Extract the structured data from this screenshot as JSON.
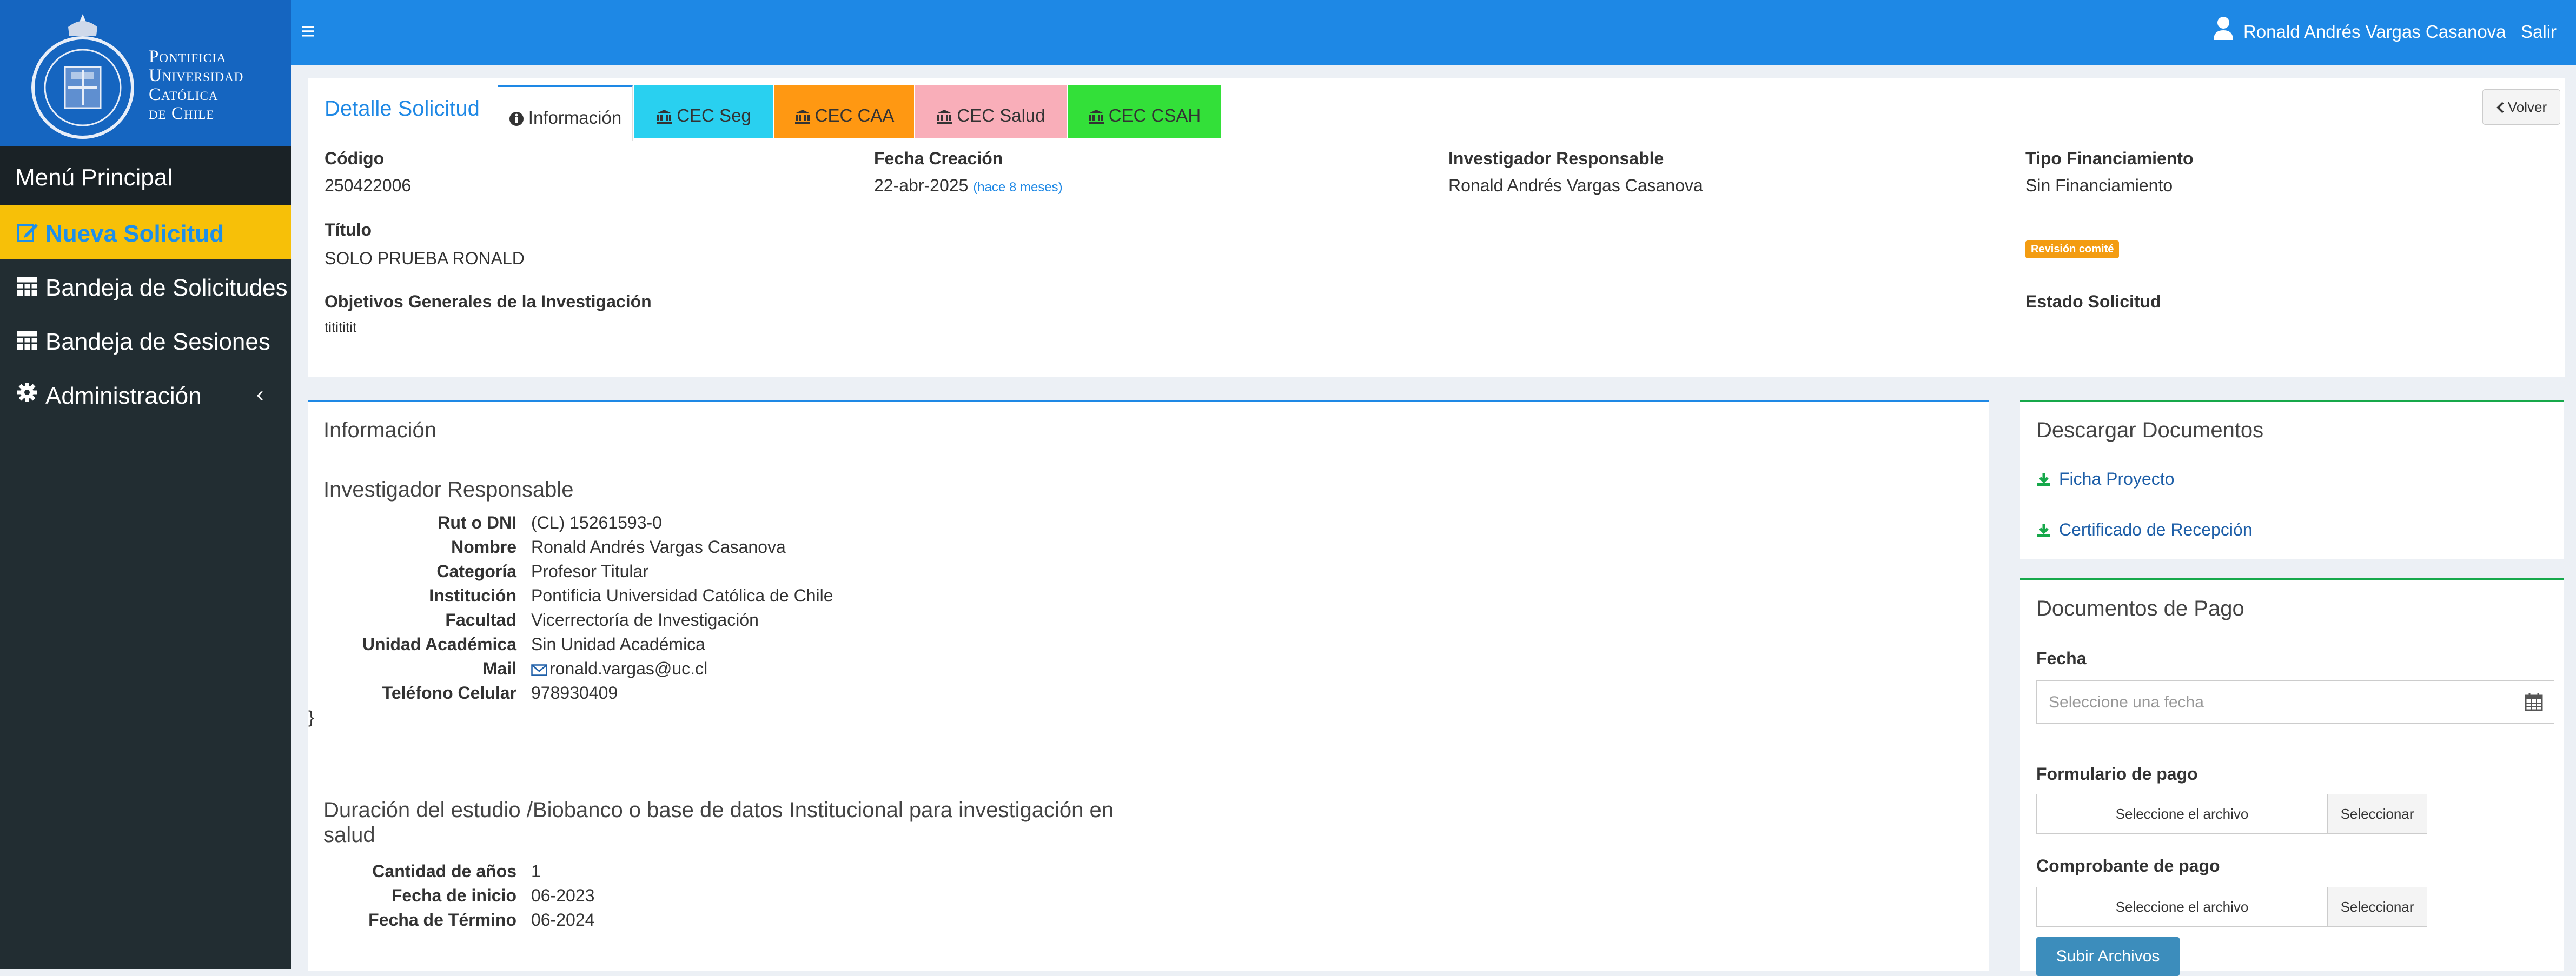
{
  "logo": {
    "lines": [
      "Pontificia",
      "Universidad",
      "Católica",
      "de Chile"
    ]
  },
  "menu": {
    "header": "Menú Principal",
    "items": [
      {
        "label": "Nueva Solicitud",
        "icon": "edit-icon"
      },
      {
        "label": "Bandeja de Solicitudes",
        "icon": "table-icon"
      },
      {
        "label": "Bandeja de Sesiones",
        "icon": "table-icon"
      },
      {
        "label": "Administración",
        "icon": "gear-icon",
        "chevron": "‹"
      }
    ]
  },
  "topbar": {
    "hamburger": "≡",
    "user_name": "Ronald Andrés Vargas Casanova",
    "logout": "Salir"
  },
  "detail": {
    "title": "Detalle Solicitud",
    "tabs": [
      {
        "label": "Información",
        "icon": "info-icon"
      },
      {
        "label": "CEC Seg",
        "icon": "institution-icon",
        "color": "#29d0f0"
      },
      {
        "label": "CEC CAA",
        "icon": "institution-icon",
        "color": "#ff9812"
      },
      {
        "label": "CEC Salud",
        "icon": "institution-icon",
        "color": "#f9aeb9"
      },
      {
        "label": "CEC CSAH",
        "icon": "institution-icon",
        "color": "#33e039"
      }
    ],
    "back": "Volver",
    "fields": {
      "codigo": {
        "label": "Código",
        "value": "250422006"
      },
      "fecha": {
        "label": "Fecha Creación",
        "value": "22-abr-2025",
        "relative": "(hace 8 meses)"
      },
      "investigador": {
        "label": "Investigador Responsable",
        "value": "Ronald Andrés Vargas Casanova"
      },
      "financiamiento": {
        "label": "Tipo Financiamiento",
        "value": "Sin Financiamiento"
      },
      "titulo": {
        "label": "Título",
        "value": "SOLO PRUEBA RONALD"
      },
      "objetivos": {
        "label": "Objetivos Generales de la Investigación",
        "value": "titititit"
      },
      "estado": {
        "label": "Estado Solicitud",
        "value": "Revisión comité",
        "color": "#f39c12"
      }
    }
  },
  "info": {
    "title": "Información",
    "investigador_section": {
      "title": "Investigador Responsable",
      "rows": [
        {
          "k": "Rut o DNI",
          "v": "(CL) 15261593-0"
        },
        {
          "k": "Nombre",
          "v": "Ronald Andrés Vargas Casanova"
        },
        {
          "k": "Categoría",
          "v": "Profesor Titular"
        },
        {
          "k": "Institución",
          "v": "Pontificia Universidad Católica de Chile"
        },
        {
          "k": "Facultad",
          "v": "Vicerrectoría de Investigación"
        },
        {
          "k": "Unidad Académica",
          "v": "Sin Unidad Académica"
        },
        {
          "k": "Mail",
          "v": "ronald.vargas@uc.cl"
        },
        {
          "k": "Teléfono Celular",
          "v": "978930409"
        }
      ]
    },
    "duracion_section": {
      "title": "Duración del estudio /Biobanco o base de datos Institucional para investigación en salud",
      "rows": [
        {
          "k": "Cantidad de años",
          "v": "1"
        },
        {
          "k": "Fecha de inicio",
          "v": "06-2023"
        },
        {
          "k": "Fecha de Término",
          "v": "06-2024"
        }
      ]
    }
  },
  "descargas": {
    "title": "Descargar Documentos",
    "links": [
      "Ficha Proyecto",
      "Certificado de Recepción"
    ]
  },
  "pago": {
    "title": "Documentos de Pago",
    "fecha_label": "Fecha",
    "fecha_placeholder": "Seleccione una fecha",
    "formulario_label": "Formulario de pago",
    "comprobante_label": "Comprobante de pago",
    "file_placeholder": "Seleccione el archivo",
    "file_button": "Seleccionar",
    "submit": "Subir Archivos"
  },
  "colors": {
    "primary": "#1e88e5",
    "sidebar": "#222d32",
    "active": "#f7c008",
    "success": "#16a84a"
  }
}
